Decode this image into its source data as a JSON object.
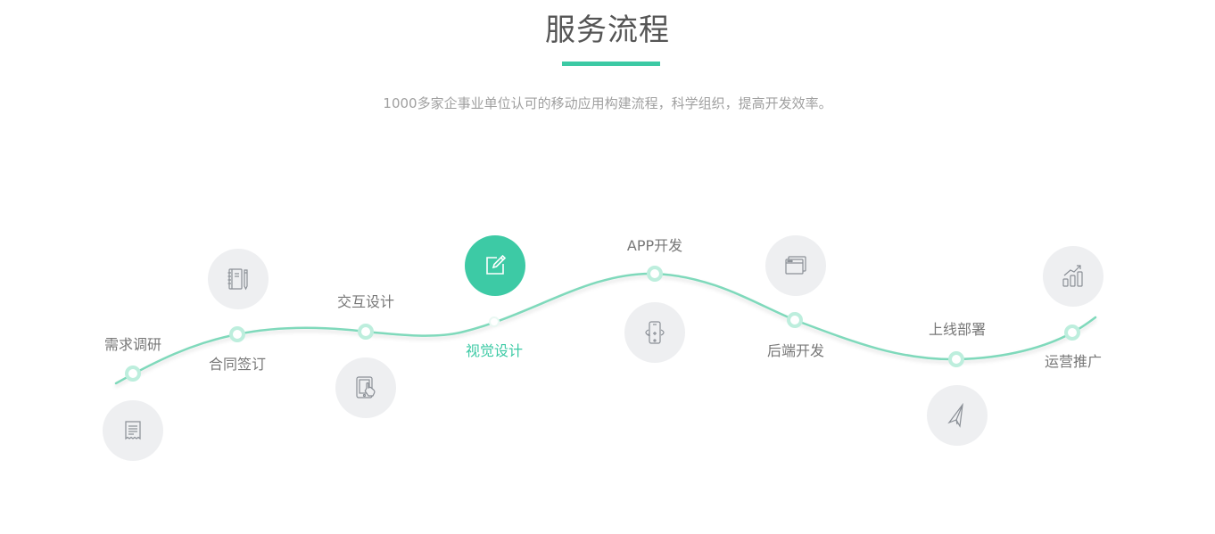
{
  "header": {
    "title": "服务流程",
    "subtitle": "1000多家企事业单位认可的移动应用构建流程，科学组织，提高开发效率。"
  },
  "colors": {
    "accent": "#3dcaa5",
    "curve": "#7fd9bb",
    "node_ring": "#bdeedd",
    "icon_bg": "#eeeff1",
    "icon_stroke": "#8a8f96",
    "label": "#777777"
  },
  "steps": [
    {
      "key": "requirements",
      "label": "需求调研",
      "icon": "receipt-icon",
      "active": false
    },
    {
      "key": "contract",
      "label": "合同签订",
      "icon": "notebook-icon",
      "active": false
    },
    {
      "key": "interaction",
      "label": "交互设计",
      "icon": "tablet-touch-icon",
      "active": false
    },
    {
      "key": "visual",
      "label": "视觉设计",
      "icon": "edit-icon",
      "active": true
    },
    {
      "key": "app",
      "label": "APP开发",
      "icon": "phone-rotate-icon",
      "active": false
    },
    {
      "key": "backend",
      "label": "后端开发",
      "icon": "browser-windows-icon",
      "active": false
    },
    {
      "key": "deploy",
      "label": "上线部署",
      "icon": "paper-plane-icon",
      "active": false
    },
    {
      "key": "promotion",
      "label": "运营推广",
      "icon": "growth-chart-icon",
      "active": false
    }
  ]
}
